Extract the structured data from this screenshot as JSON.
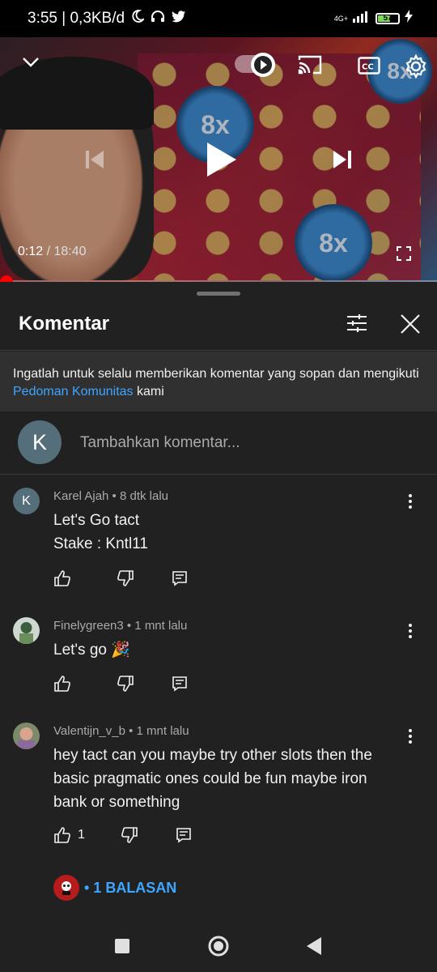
{
  "status_bar": {
    "time_speed": "3:55 | 0,3KB/d",
    "network": "4G+",
    "battery": "57"
  },
  "player": {
    "current_time": "0:12",
    "duration": "18:40",
    "progress_fraction": 0.011,
    "overlay_text": "8x",
    "icons": [
      "chevron-down-icon",
      "autoplay-toggle",
      "cast-icon",
      "captions-icon",
      "gear-icon",
      "previous-icon",
      "play-icon",
      "next-icon",
      "fullscreen-icon"
    ]
  },
  "comments_panel": {
    "title": "Komentar",
    "notice": {
      "prefix": "Ingatlah untuk selalu memberikan komentar yang sopan dan mengikuti ",
      "link": "Pedoman Komunitas",
      "suffix": " kami"
    },
    "add_comment": {
      "avatar_letter": "K",
      "placeholder": "Tambahkan komentar..."
    },
    "comments": [
      {
        "avatar_letter": "K",
        "meta": "Karel Ajah • 8 dtk lalu",
        "lines": [
          "Let's Go tact",
          "Stake : Kntl11"
        ],
        "likes": ""
      },
      {
        "avatar_letter": "",
        "meta": "Finelygreen3 • 1 mnt lalu",
        "lines": [
          "Let's go 🎉"
        ],
        "likes": ""
      },
      {
        "avatar_letter": "",
        "meta": "Valentijn_v_b • 1 mnt lalu",
        "lines": [
          "hey tact can you maybe try other slots then the",
          "basic pragmatic ones could be fun maybe iron",
          "bank or something"
        ],
        "likes": "1"
      }
    ],
    "replies_label": "• 1 BALASAN"
  },
  "colors": {
    "background": "#212121",
    "notice_bg": "#303030",
    "link": "#3ea6ff",
    "progress": "#ff0000",
    "meta_text": "#aaaaaa"
  }
}
